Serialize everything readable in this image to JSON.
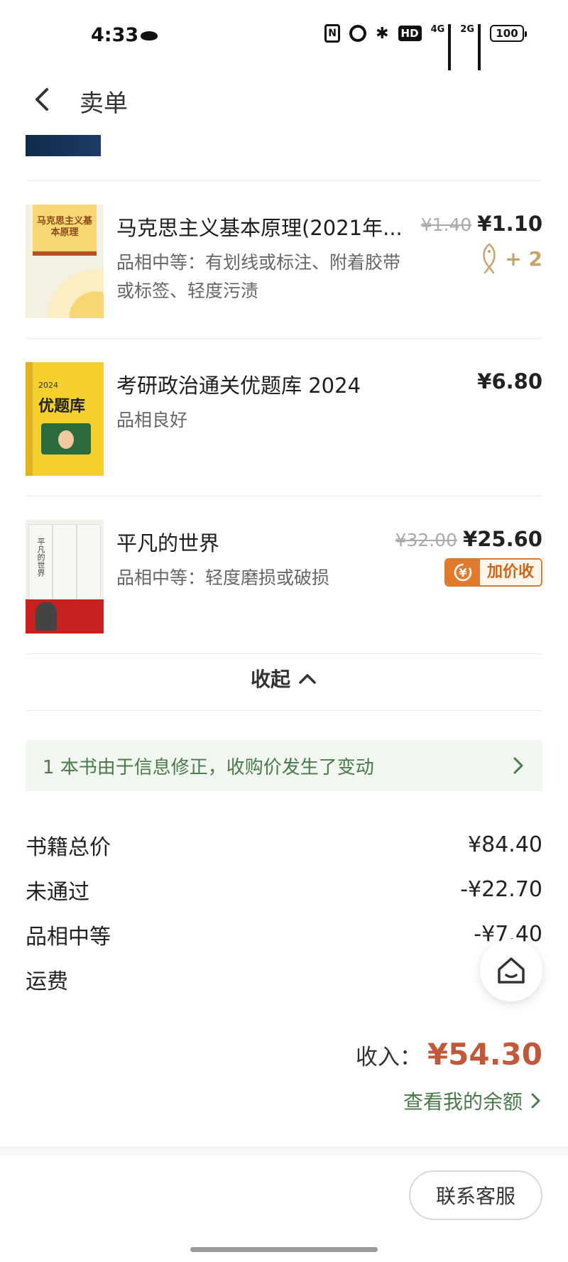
{
  "status_bar": {
    "time": "4:33",
    "nfc": "N",
    "hd": "HD",
    "net1": "4G",
    "net2": "2G",
    "battery": "100"
  },
  "header": {
    "title": "卖单"
  },
  "books": [
    {
      "title": "马克思主义基本原理(2021年...",
      "condition": "品相中等：有划线或标注、附着胶带或标签、轻度污渍",
      "price_old": "¥1.40",
      "price_new": "¥1.10",
      "bonus": "+ 2",
      "cover_text": "马克思主义基本原理",
      "cover_icon": "book-cover-marx"
    },
    {
      "title": "考研政治通关优题库 2024",
      "condition": "品相良好",
      "price_new": "¥6.80",
      "cover_text": "优题库",
      "cover_subtext": "2024",
      "cover_icon": "book-cover-exam"
    },
    {
      "title": "平凡的世界",
      "condition": "品相中等：轻度磨损或破损",
      "price_old": "¥32.00",
      "price_new": "¥25.60",
      "badge": "加价收",
      "cover_text": "平凡的世界",
      "cover_icon": "book-cover-world"
    }
  ],
  "collapse": {
    "label": "收起"
  },
  "notice": {
    "text": "1 本书由于信息修正，收购价发生了变动"
  },
  "summary": [
    {
      "label": "书籍总价",
      "value": "¥84.40"
    },
    {
      "label": "未通过",
      "value": "-¥22.70"
    },
    {
      "label": "品相中等",
      "value": "-¥7.40"
    },
    {
      "label": "运费",
      "value": ""
    }
  ],
  "income": {
    "label": "收入：",
    "value": "¥54.30"
  },
  "balance": {
    "label": "查看我的余额"
  },
  "contact": {
    "label": "联系客服"
  },
  "colors": {
    "accent_green": "#4a7a4c",
    "income_red": "#c0583a",
    "badge_orange": "#e07b2d",
    "bonus_gold": "#c8a46b"
  },
  "icons": [
    "back-icon",
    "fish-icon",
    "yen-exchange-icon",
    "chevron-up-icon",
    "chevron-right-icon",
    "home-icon"
  ]
}
